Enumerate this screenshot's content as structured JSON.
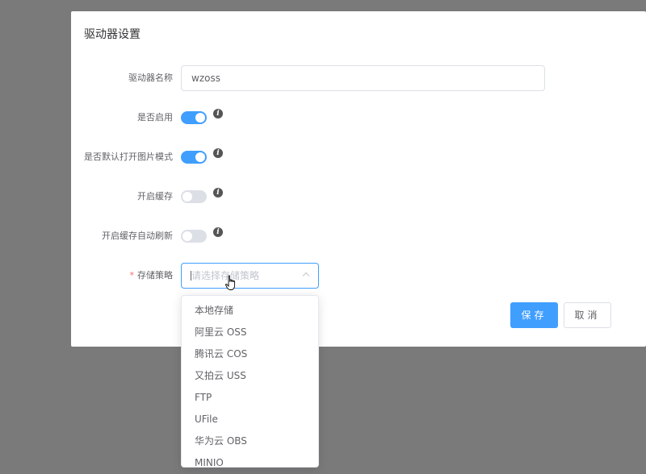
{
  "dialog": {
    "title": "驱动器设置"
  },
  "form": {
    "name": {
      "label": "驱动器名称",
      "value": "wzoss"
    },
    "enable": {
      "label": "是否启用",
      "on": true
    },
    "image_mode": {
      "label": "是否默认打开图片模式",
      "on": true
    },
    "cache": {
      "label": "开启缓存",
      "on": false
    },
    "cache_refresh": {
      "label": "开启缓存自动刷新",
      "on": false
    },
    "storage": {
      "required_mark": "*",
      "label": "存储策略",
      "placeholder": "请选择存储策略"
    }
  },
  "info_icon_glyph": "i",
  "buttons": {
    "save": "保存",
    "cancel": "取消"
  },
  "dropdown": {
    "options": [
      "本地存储",
      "阿里云 OSS",
      "腾讯云 COS",
      "又拍云 USS",
      "FTP",
      "UFile",
      "华为云 OBS",
      "MINIO"
    ]
  },
  "colors": {
    "primary": "#409eff",
    "overlay": "#7a7a7a",
    "required": "#f56c6c"
  }
}
